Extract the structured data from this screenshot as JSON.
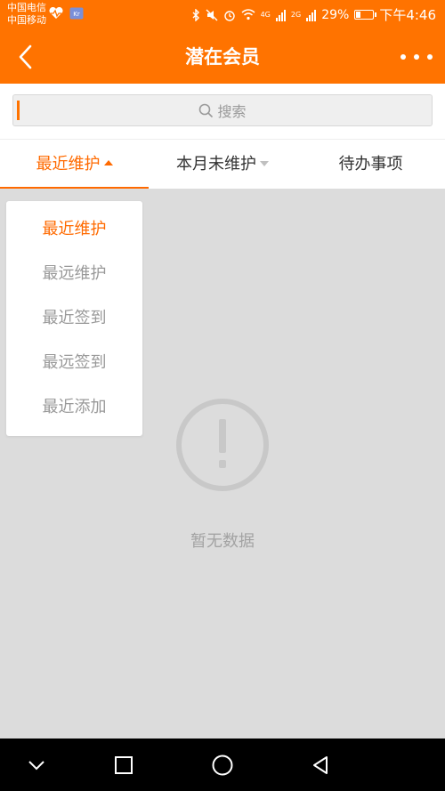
{
  "status_bar": {
    "carrier1": "中国电信",
    "carrier2": "中国移动",
    "network1": "4G",
    "network2": "2G",
    "battery": "29%",
    "time": "下午4:46"
  },
  "navbar": {
    "title": "潜在会员"
  },
  "search": {
    "placeholder": "搜索"
  },
  "tabs": [
    {
      "label": "最近维护",
      "state": "active-expanded"
    },
    {
      "label": "本月未维护",
      "state": "collapsed"
    },
    {
      "label": "待办事项",
      "state": "plain"
    }
  ],
  "dropdown": {
    "items": [
      "最近维护",
      "最远维护",
      "最近签到",
      "最远签到",
      "最近添加"
    ],
    "selected": "最近维护"
  },
  "empty_state": {
    "text": "暂无数据",
    "icon": "exclamation-circle-icon"
  },
  "colors": {
    "accent": "#ff7300",
    "active_text": "#ff6a00"
  }
}
